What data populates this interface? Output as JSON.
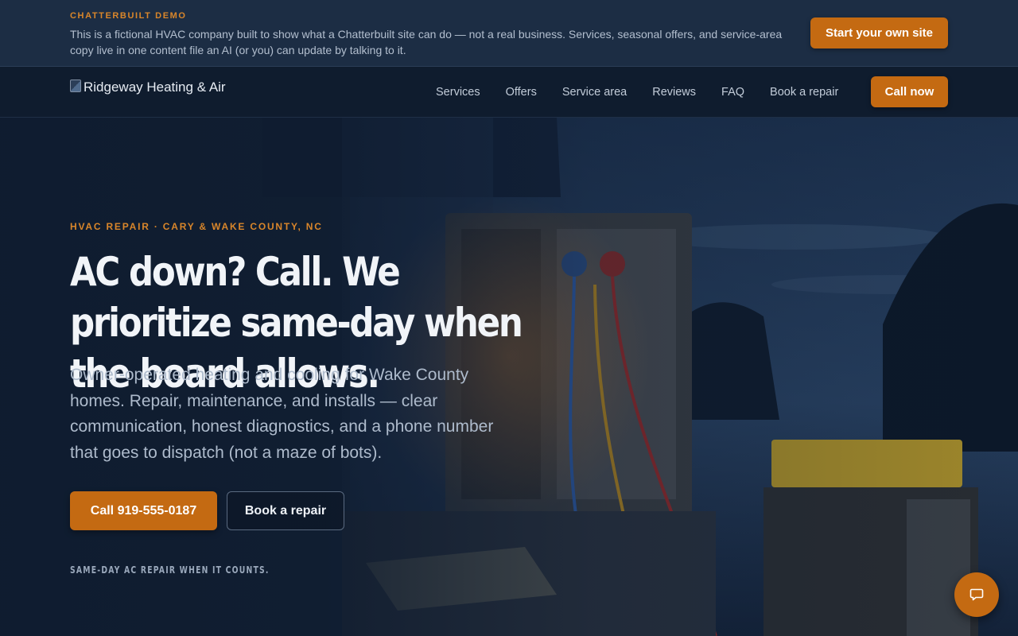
{
  "demo_banner": {
    "eyebrow": "CHATTERBUILT DEMO",
    "text": "This is a fictional HVAC company built to show what a Chatterbuilt site can do — not a real business. Services, seasonal offers, and service-area copy live in one content file an AI (or you) can update by talking to it.",
    "cta_label": "Start your own site"
  },
  "header": {
    "logo_text": "Ridgeway Heating & Air",
    "nav": [
      "Services",
      "Offers",
      "Service area",
      "Reviews",
      "FAQ",
      "Book a repair"
    ],
    "call_label": "Call now"
  },
  "hero": {
    "eyebrow": "HVAC REPAIR · CARY & WAKE COUNTY, NC",
    "headline": "AC down? Call. We prioritize same-day when the board allows.",
    "subcopy": "Owner-operated heating and cooling for Wake County homes. Repair, maintenance, and installs — clear communication, honest diagnostics, and a phone number that goes to dispatch (not a maze of bots).",
    "primary_cta": "Call 919-555-0187",
    "secondary_cta": "Book a repair",
    "tagline": "SAME-DAY AC REPAIR WHEN IT COUNTS."
  },
  "chat": {
    "icon": "chat-bubble-icon"
  },
  "colors": {
    "accent": "#c46a12",
    "eyebrow": "#d9862a",
    "background": "#0f1c2e"
  }
}
